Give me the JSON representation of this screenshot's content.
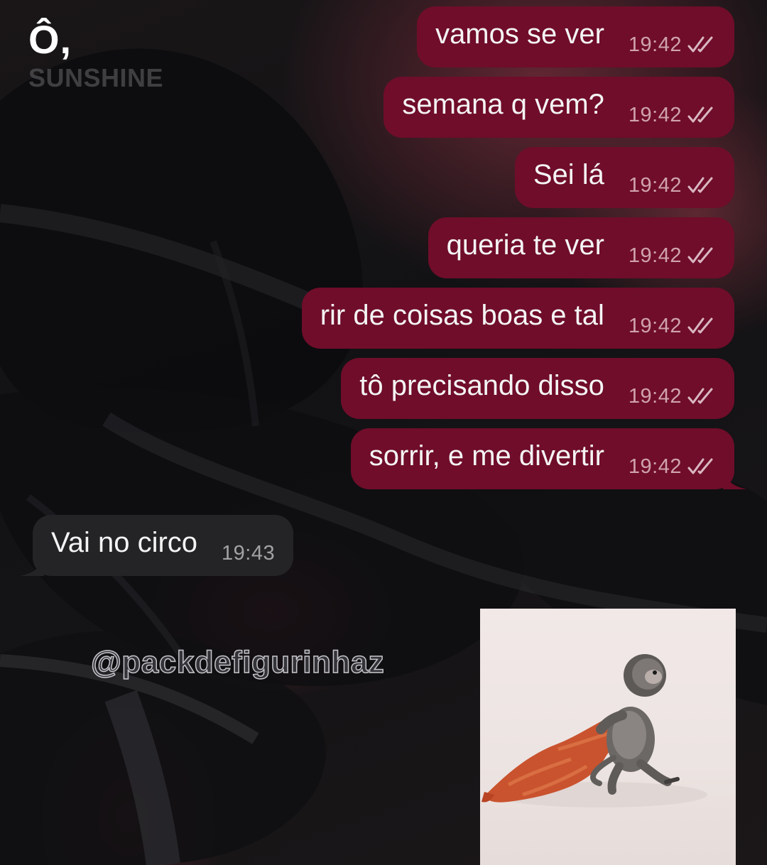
{
  "header": {
    "logo_mark": "Ô,",
    "logo_sub": "SUNSHINE"
  },
  "messages": [
    {
      "direction": "out",
      "text": "vamos se ver",
      "time": "19:42",
      "status": "read"
    },
    {
      "direction": "out",
      "text": "semana q vem?",
      "time": "19:42",
      "status": "read"
    },
    {
      "direction": "out",
      "text": "Sei lá",
      "time": "19:42",
      "status": "read"
    },
    {
      "direction": "out",
      "text": "queria te ver",
      "time": "19:42",
      "status": "read"
    },
    {
      "direction": "out",
      "text": "rir de coisas boas e tal",
      "time": "19:42",
      "status": "read"
    },
    {
      "direction": "out",
      "text": "tô precisando disso",
      "time": "19:42",
      "status": "read"
    },
    {
      "direction": "out",
      "text": "sorrir, e me divertir",
      "time": "19:42",
      "status": "read"
    },
    {
      "direction": "in",
      "text": "Vai no circo",
      "time": "19:43"
    }
  ],
  "watermark": "@packdefigurinhaz",
  "sticker": {
    "icon": "monkey-with-orange-cloth-sticker"
  },
  "colors": {
    "outgoing_bubble": "#6f0d2a",
    "incoming_bubble": "#242427",
    "background": "#121214"
  }
}
